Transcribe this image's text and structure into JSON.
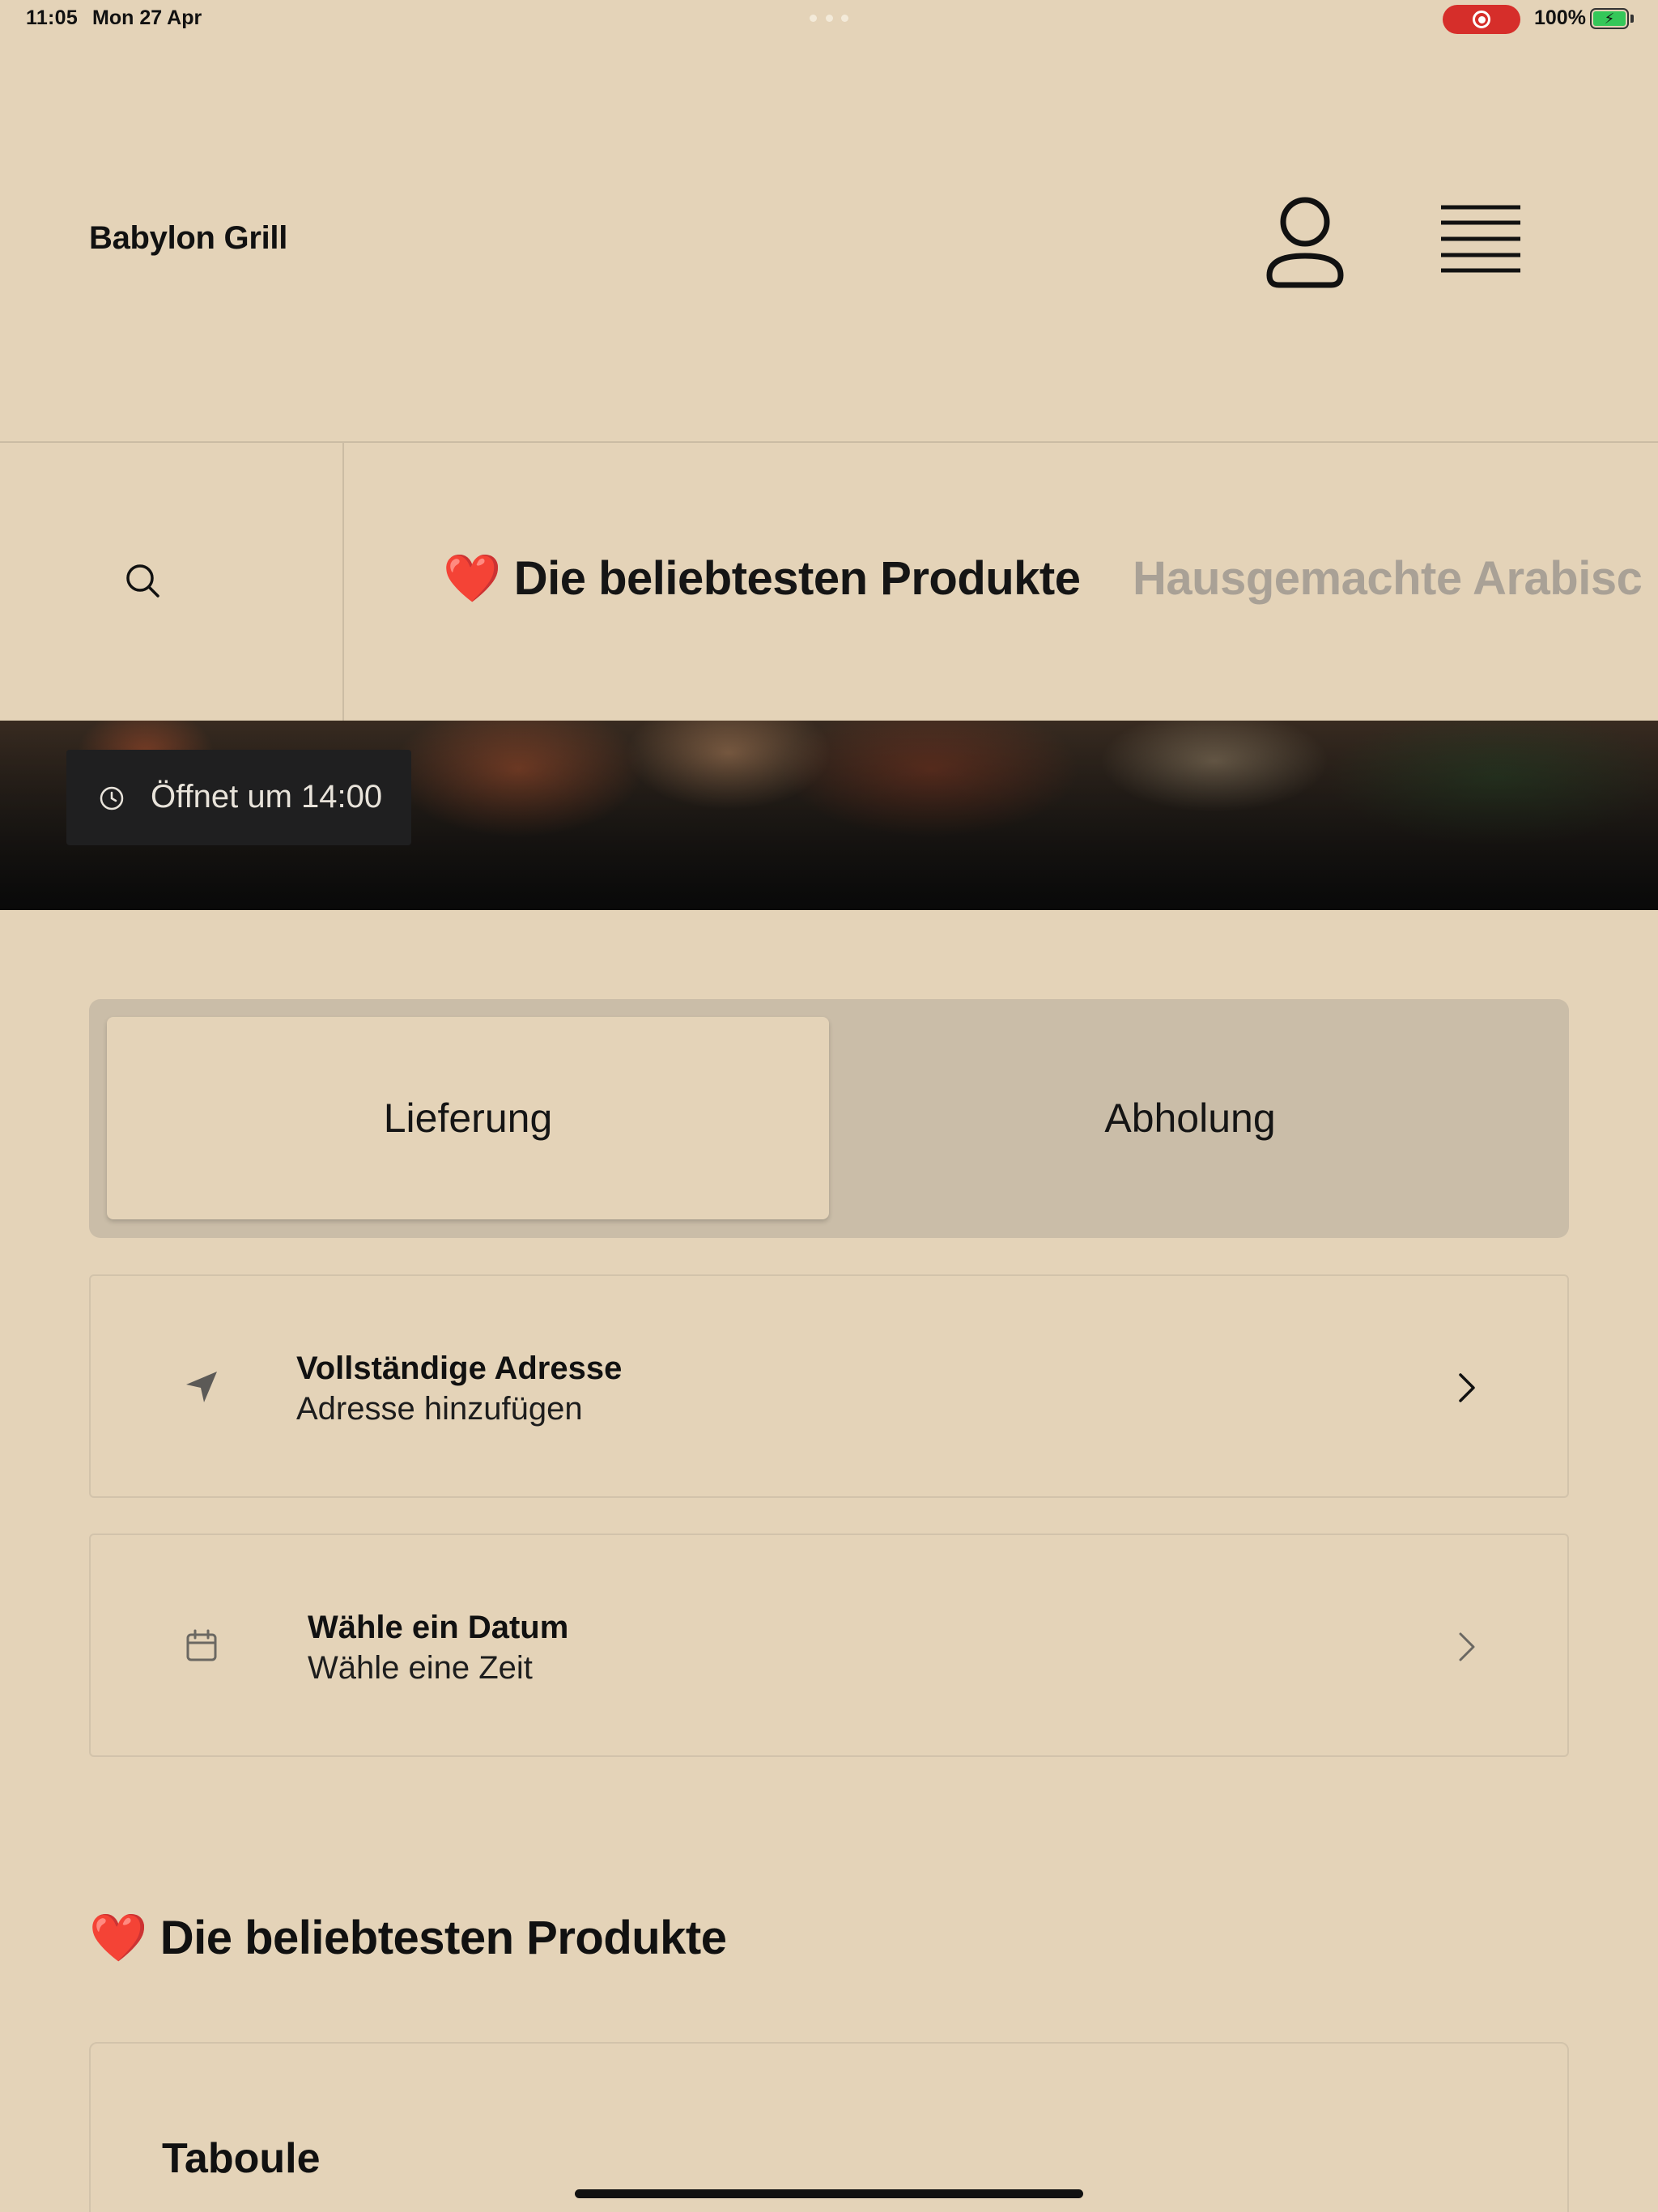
{
  "status_bar": {
    "time": "11:05",
    "date": "Mon 27 Apr",
    "battery_percent": "100%",
    "battery_level": 1.0,
    "recording": true,
    "colors": {
      "record": "#d62e2a",
      "battery": "#34c759"
    }
  },
  "header": {
    "brand": "Babylon Grill",
    "account_icon": "person-icon",
    "menu_icon": "hamburger-icon"
  },
  "categories": {
    "search_icon": "search-icon",
    "tabs": [
      {
        "emoji": "❤️",
        "label": "Die beliebtesten Produkte",
        "active": true
      },
      {
        "emoji": "",
        "label": "Hausgemachte Arabisc",
        "active": false
      }
    ]
  },
  "hero": {
    "badge": "Öffnet um 14:00",
    "badge_icon": "clock-icon"
  },
  "order_mode": {
    "options": [
      "Lieferung",
      "Abholung"
    ],
    "selected": "Lieferung"
  },
  "address_card": {
    "title": "Vollständige Adresse",
    "subtitle": "Adresse hinzufügen",
    "icon": "location-arrow-icon"
  },
  "date_card": {
    "title": "Wähle ein Datum",
    "subtitle": "Wähle eine Zeit",
    "icon": "calendar-icon"
  },
  "section": {
    "emoji": "❤️",
    "title": "Die beliebtesten Produkte"
  },
  "products": [
    {
      "name": "Taboule"
    }
  ],
  "theme": {
    "background": "#e4d3b8",
    "toggle_track": "#cabda8",
    "inactive_tab": "#a9a196",
    "badge_bg": "#1f1f20"
  }
}
